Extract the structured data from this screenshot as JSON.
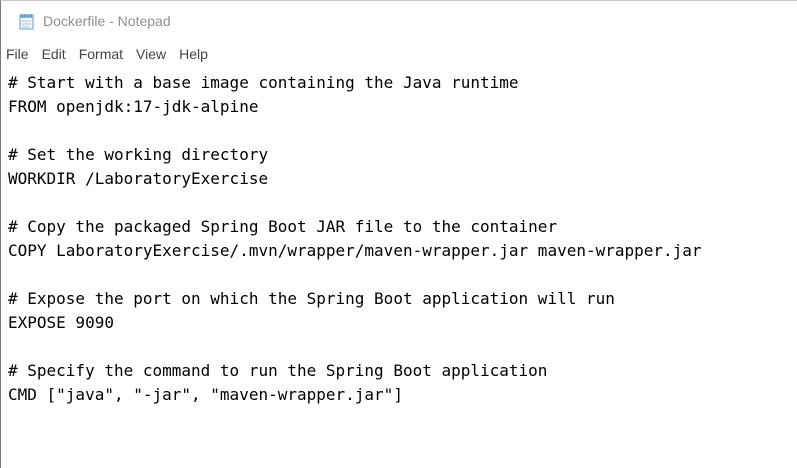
{
  "window": {
    "title": "Dockerfile - Notepad",
    "app_icon": "notepad-icon"
  },
  "menu": [
    {
      "label": "File"
    },
    {
      "label": "Edit"
    },
    {
      "label": "Format"
    },
    {
      "label": "View"
    },
    {
      "label": "Help"
    }
  ],
  "editor": {
    "lines": [
      "# Start with a base image containing the Java runtime",
      "FROM openjdk:17-jdk-alpine",
      "",
      "# Set the working directory",
      "WORKDIR /LaboratoryExercise",
      "",
      "# Copy the packaged Spring Boot JAR file to the container",
      "COPY LaboratoryExercise/.mvn/wrapper/maven-wrapper.jar maven-wrapper.jar",
      "",
      "# Expose the port on which the Spring Boot application will run",
      "EXPOSE 9090",
      "",
      "# Specify the command to run the Spring Boot application",
      "CMD [\"java\", \"-jar\", \"maven-wrapper.jar\"]"
    ]
  }
}
